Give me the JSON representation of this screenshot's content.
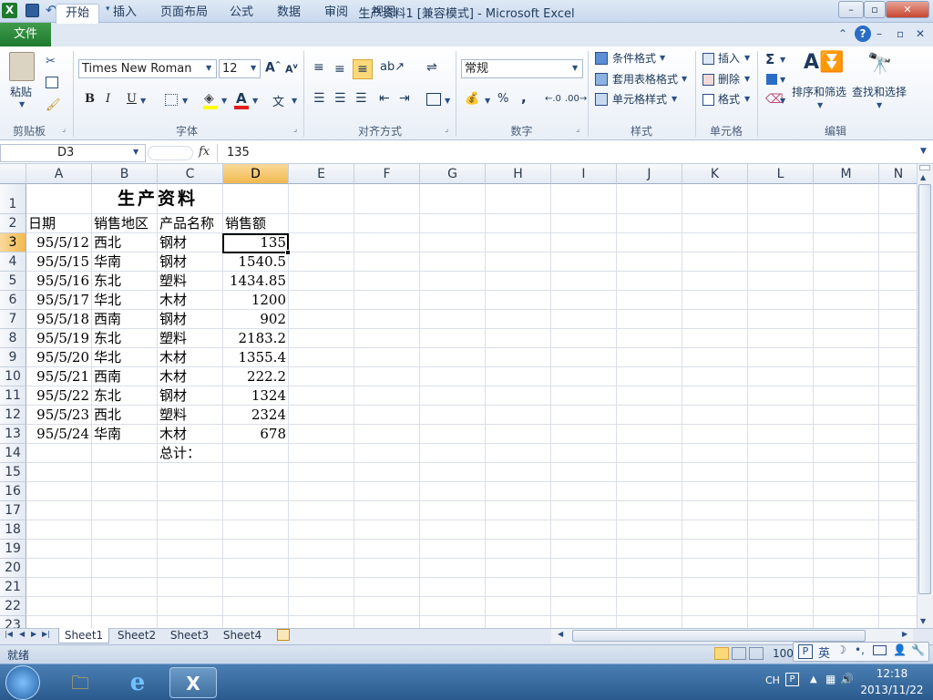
{
  "window": {
    "title": "生产资料1  [兼容模式] - Microsoft Excel",
    "app_icon": "X",
    "controls": [
      "–",
      "▫",
      "✕"
    ]
  },
  "qat": [
    "save-icon",
    "undo-icon",
    "redo-icon",
    "customize-icon"
  ],
  "ribbon_tabs": [
    "文件",
    "开始",
    "插入",
    "页面布局",
    "公式",
    "数据",
    "审阅",
    "视图"
  ],
  "ribbon": {
    "clipboard": {
      "paste": "粘贴",
      "label": "剪贴板"
    },
    "font": {
      "name": "Times New Roman",
      "size": "12",
      "bold": "B",
      "italic": "I",
      "underline": "U",
      "label": "字体"
    },
    "alignment": {
      "label": "对齐方式"
    },
    "number": {
      "format": "常规",
      "percent": "%",
      "comma": ",",
      "label": "数字"
    },
    "styles": {
      "conditional": "条件格式",
      "table": "套用表格格式",
      "cell_styles": "单元格样式",
      "label": "样式"
    },
    "cells": {
      "insert": "插入",
      "delete": "删除",
      "format": "格式",
      "label": "单元格"
    },
    "editing": {
      "sort": "排序和筛选",
      "find": "查找和选择",
      "label": "编辑"
    }
  },
  "formula_bar": {
    "name_box": "D3",
    "fx": "fx",
    "content": "135"
  },
  "columns": [
    "A",
    "B",
    "C",
    "D",
    "E",
    "F",
    "G",
    "H",
    "I",
    "J",
    "K",
    "L",
    "M",
    "N"
  ],
  "rows": [
    "1",
    "2",
    "3",
    "4",
    "5",
    "6",
    "7",
    "8",
    "9",
    "10",
    "11",
    "12",
    "13",
    "14",
    "15",
    "16",
    "17",
    "18",
    "19",
    "20",
    "21",
    "22",
    "23"
  ],
  "sheet": {
    "title": "生产资料",
    "headers": [
      "日期",
      "销售地区",
      "产品名称",
      "销售额"
    ],
    "data": [
      [
        "95/5/12",
        "西北",
        "钢材",
        "135"
      ],
      [
        "95/5/15",
        "华南",
        "钢材",
        "1540.5"
      ],
      [
        "95/5/16",
        "东北",
        "塑料",
        "1434.85"
      ],
      [
        "95/5/17",
        "华北",
        "木材",
        "1200"
      ],
      [
        "95/5/18",
        "西南",
        "钢材",
        "902"
      ],
      [
        "95/5/19",
        "东北",
        "塑料",
        "2183.2"
      ],
      [
        "95/5/20",
        "华北",
        "木材",
        "1355.4"
      ],
      [
        "95/5/21",
        "西南",
        "木材",
        "222.2"
      ],
      [
        "95/5/22",
        "东北",
        "钢材",
        "1324"
      ],
      [
        "95/5/23",
        "西北",
        "塑料",
        "2324"
      ],
      [
        "95/5/24",
        "华南",
        "木材",
        "678"
      ]
    ],
    "total_label": "总计："
  },
  "sheet_tabs": [
    "Sheet1",
    "Sheet2",
    "Sheet3",
    "Sheet4"
  ],
  "status": {
    "ready": "就绪",
    "zoom": "100",
    "ime": "英"
  },
  "taskbar": {
    "lang": "CH",
    "time": "12:18",
    "date": "2013/11/22"
  }
}
